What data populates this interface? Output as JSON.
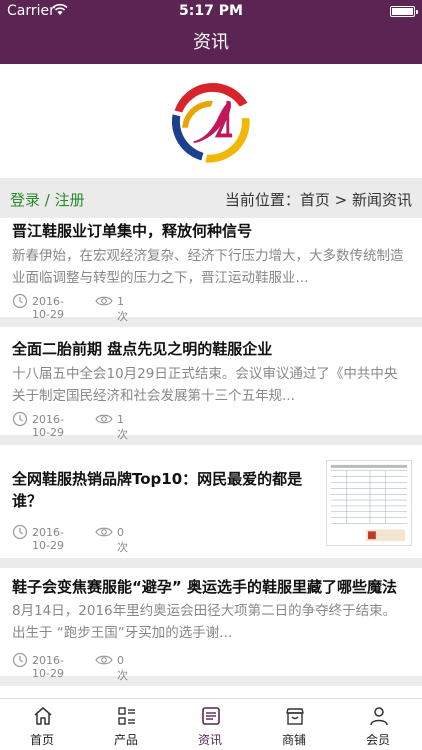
{
  "status_bar": {
    "carrier": "Carrier",
    "time": "5:17 PM"
  },
  "nav": {
    "title": "资讯"
  },
  "location_bar": {
    "login": "登录",
    "separator": "/",
    "register": "注册",
    "breadcrumb": "当前位置：首页 > 新闻资讯"
  },
  "news": [
    {
      "title": "晋江鞋服业订单集中，释放何种信号",
      "summary": "新春伊始，在宏观经济复杂、经济下行压力增大，大多数传统制造业面临调整与转型的压力之下，晋江运动鞋服业...",
      "date": "2016-10-29",
      "views": "1次"
    },
    {
      "title": "全面二胎前期 盘点先见之明的鞋服企业",
      "summary": "十八届五中全会10月29日正式结束。会议审议通过了《中共中央关于制定国民经济和社会发展第十三个五年规...",
      "date": "2016-10-29",
      "views": "1次"
    },
    {
      "title": "全网鞋服热销品牌Top10：网民最爱的都是谁？",
      "summary": "",
      "date": "2016-10-29",
      "views": "0次"
    },
    {
      "title": "鞋子会变焦赛服能“避孕” 奥运选手的鞋服里藏了哪些魔法",
      "summary": "8月14日，2016年里约奥运会田径大项第二日的争夺终于结束。     出生于 “跑步王国”牙买加的选手谢...",
      "date": "2016-10-29",
      "views": "0次"
    }
  ],
  "tabs": [
    {
      "label": "首页",
      "icon": "home-icon"
    },
    {
      "label": "产品",
      "icon": "list-icon"
    },
    {
      "label": "资讯",
      "icon": "news-icon"
    },
    {
      "label": "商铺",
      "icon": "shop-icon"
    },
    {
      "label": "会员",
      "icon": "user-icon"
    }
  ],
  "colors": {
    "brand": "#5b2453",
    "login_green": "#2a8a2a"
  }
}
